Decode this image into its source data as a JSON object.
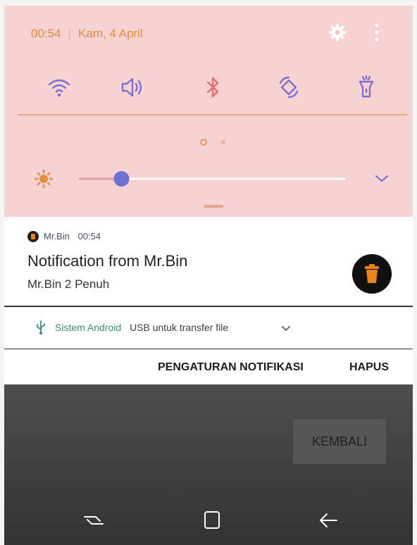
{
  "status_bar": {
    "time": "00:54",
    "separator": "|",
    "date": "Kam, 4 April"
  },
  "icons": {
    "settings": "gear-icon",
    "more": "more-vert-icon",
    "quick_settings": [
      "wifi-icon",
      "sound-icon",
      "bluetooth-icon",
      "auto-rotate-icon",
      "flashlight-icon"
    ],
    "brightness": "brightness-icon",
    "expand": "chevron-down-icon",
    "app": "mr-bin-trash-icon",
    "usb": "usb-icon",
    "nav": [
      "recent-apps-icon",
      "home-icon",
      "back-icon"
    ]
  },
  "brightness": {
    "level": 0.16
  },
  "page_indicator": {
    "pages": 2,
    "active": 0
  },
  "notification": {
    "app_name": "Mr.Bin",
    "time": "00:54",
    "title": "Notification from Mr.Bin",
    "text": "Mr.Bin 2 Penuh"
  },
  "system_notification": {
    "source": "Sistem Android",
    "text": "USB untuk transfer file"
  },
  "actions": {
    "settings_label": "PENGATURAN NOTIFIKASI",
    "clear_label": "HAPUS"
  },
  "app_button": {
    "label": "KEMBALI"
  },
  "colors": {
    "panel_bg": "#f6d2d2",
    "accent_orange": "#e38a3c",
    "icon_purple": "#7b6fd0",
    "slider_thumb": "#6f70d6",
    "bin_orange": "#e8821e"
  }
}
